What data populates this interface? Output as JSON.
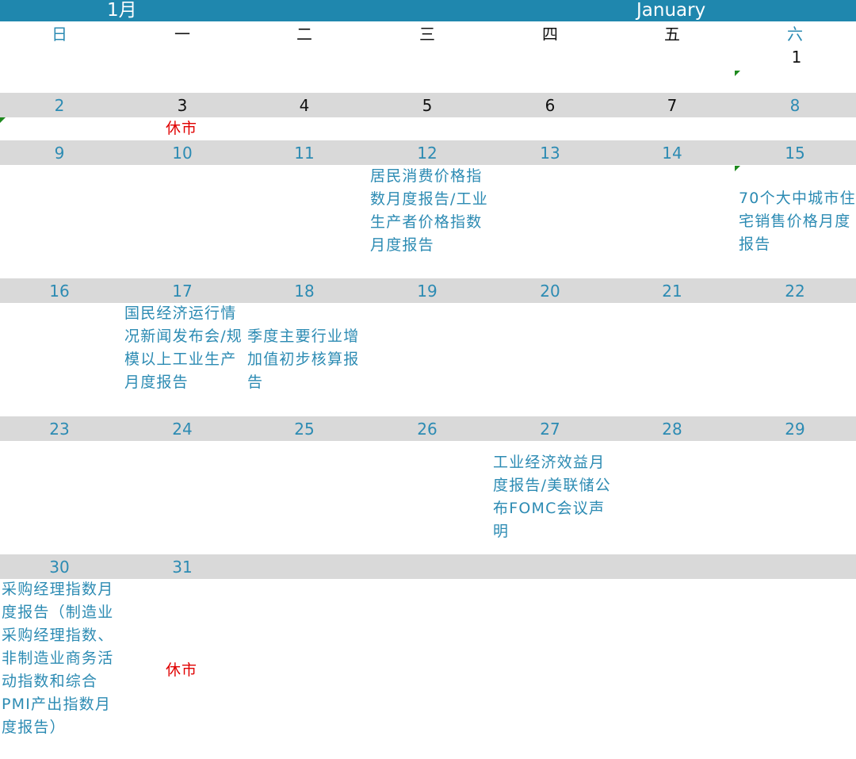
{
  "header": {
    "month_cn": "1月",
    "month_en": "January"
  },
  "weekdays": [
    "日",
    "一",
    "二",
    "三",
    "四",
    "五",
    "六"
  ],
  "days": [
    "1",
    "2",
    "3",
    "4",
    "5",
    "6",
    "7",
    "8",
    "9",
    "10",
    "11",
    "12",
    "13",
    "14",
    "15",
    "16",
    "17",
    "18",
    "19",
    "20",
    "21",
    "22",
    "23",
    "24",
    "25",
    "26",
    "27",
    "28",
    "29",
    "30",
    "31"
  ],
  "events": {
    "jan3": "休市",
    "jan12": "居民消费价格指数月度报告/工业生产者价格指数月度报告",
    "jan15": "70个大中城市住宅销售价格月度报告",
    "jan17": "国民经济运行情况新闻发布会/规模以上工业生产月度报告",
    "jan18": "季度主要行业增加值初步核算报告",
    "jan27": "工业经济效益月度报告/美联储公布FOMC会议声明",
    "jan30": "采购经理指数月度报告（制造业采购经理指数、非制造业商务活动指数和综合PMI产出指数月度报告）",
    "jan31": "休市"
  },
  "colors": {
    "header": "#1f87ae",
    "band": "#d9d9d9",
    "accent": "#2c8bb3",
    "closed": "#e00000",
    "flag": "#1e8a1e"
  }
}
